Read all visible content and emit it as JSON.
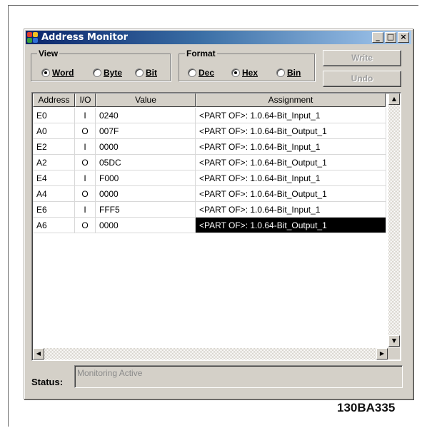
{
  "window": {
    "title": "Address Monitor",
    "minimize_label": "_",
    "maximize_label": "□",
    "close_label": "×"
  },
  "view": {
    "title": "View",
    "options": [
      "Word",
      "Byte",
      "Bit"
    ],
    "selected": "Word"
  },
  "format": {
    "title": "Format",
    "options": [
      "Dec",
      "Hex",
      "Bin"
    ],
    "selected": "Hex"
  },
  "buttons": {
    "write": "Write",
    "undo": "Undo"
  },
  "table": {
    "columns": [
      "Address",
      "I/O",
      "Value",
      "Assignment"
    ],
    "rows": [
      {
        "address": "E0",
        "io": "I",
        "value": "0240",
        "assignment": "<PART OF>: 1.0.64-Bit_Input_1"
      },
      {
        "address": "A0",
        "io": "O",
        "value": "007F",
        "assignment": "<PART OF>: 1.0.64-Bit_Output_1"
      },
      {
        "address": "E2",
        "io": "I",
        "value": "0000",
        "assignment": "<PART OF>: 1.0.64-Bit_Input_1"
      },
      {
        "address": "A2",
        "io": "O",
        "value": "05DC",
        "assignment": "<PART OF>: 1.0.64-Bit_Output_1"
      },
      {
        "address": "E4",
        "io": "I",
        "value": "F000",
        "assignment": "<PART OF>: 1.0.64-Bit_Input_1"
      },
      {
        "address": "A4",
        "io": "O",
        "value": "0000",
        "assignment": "<PART OF>: 1.0.64-Bit_Output_1"
      },
      {
        "address": "E6",
        "io": "I",
        "value": "FFF5",
        "assignment": "<PART OF>: 1.0.64-Bit_Input_1"
      },
      {
        "address": "A6",
        "io": "O",
        "value": "0000",
        "assignment": "<PART OF>: 1.0.64-Bit_Output_1"
      }
    ],
    "selected_row": 7
  },
  "status": {
    "label": "Status:",
    "text": "Monitoring Active"
  },
  "figure_code": "130BA335",
  "colors": {
    "title_bar_start": "#0a246a",
    "title_bar_end": "#a6caf0",
    "selection": "#000000",
    "face": "#d4d0c8"
  }
}
